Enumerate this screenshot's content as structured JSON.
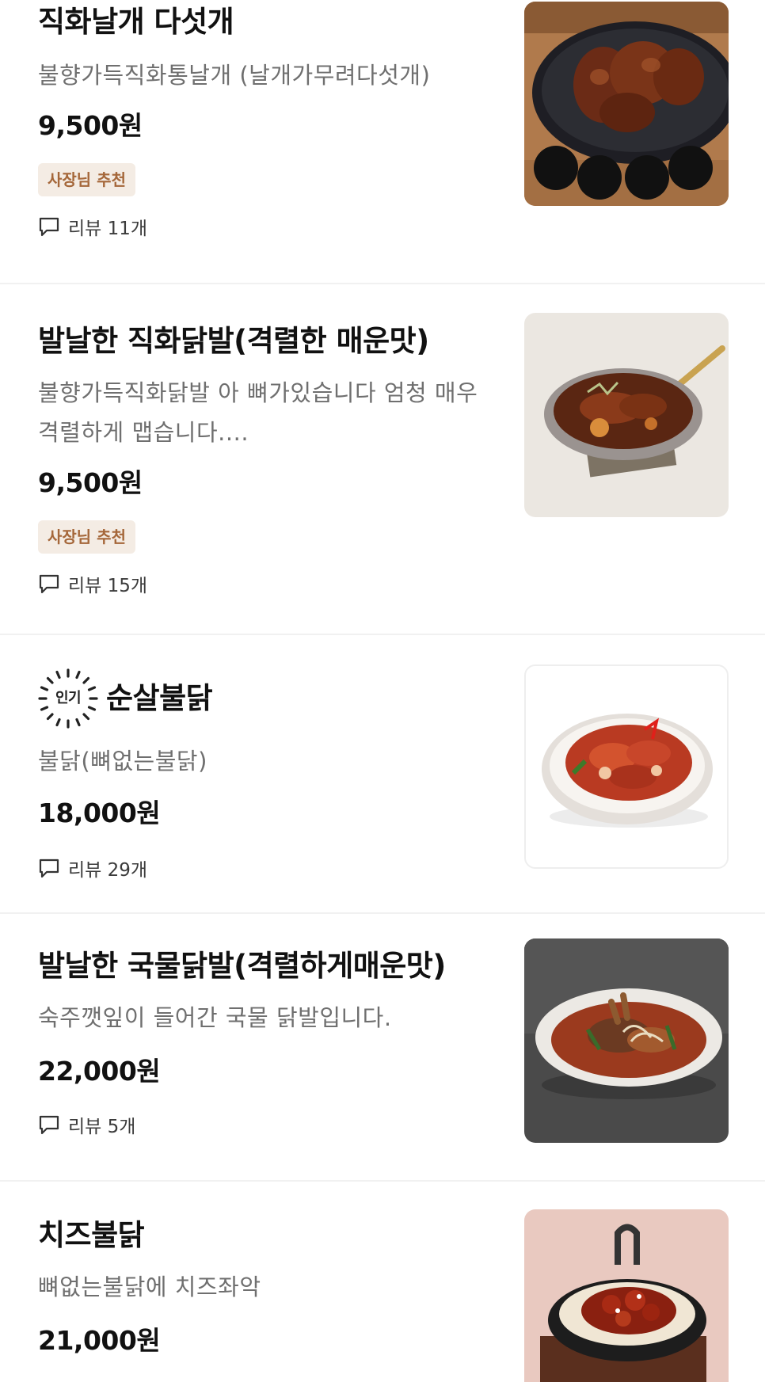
{
  "items": [
    {
      "name": "직화날개 다섯개",
      "desc": "불향가득직화통날개 (날개가무려다섯개)",
      "price": "9,500원",
      "badge": "사장님 추천",
      "review": "리뷰 11개",
      "image_icon": "grilled-wings-photo"
    },
    {
      "name": "발날한 직화닭발(격렬한 매운맛)",
      "desc_lines": [
        "불향가득직화닭발 아 뼈가있습니다 엄청 매우",
        "격렬하게 맵습니다...."
      ],
      "price": "9,500원",
      "badge": "사장님 추천",
      "review": "리뷰 15개",
      "image_icon": "chicken-feet-pan-photo"
    },
    {
      "popular_label": "인기",
      "name": "순살불닭",
      "desc": "불닭(뼈없는불닭)",
      "price": "18,000원",
      "review": "리뷰 29개",
      "image_icon": "boneless-fire-chicken-photo"
    },
    {
      "name": "발날한 국물닭발(격렬하게매운맛)",
      "desc": "숙주깻잎이 들어간 국물 닭발입니다.",
      "price": "22,000원",
      "review": "리뷰 5개",
      "image_icon": "soup-chicken-feet-photo"
    },
    {
      "name": "치즈불닭",
      "desc": "뼈없는불닭에 치즈좌악",
      "price": "21,000원",
      "image_icon": "cheese-fire-chicken-photo"
    }
  ],
  "colors": {
    "badge_text": "#a5673a",
    "badge_bg": "#f4ece4",
    "desc_text": "#6f6f6f",
    "divider": "#f1f1f1"
  }
}
